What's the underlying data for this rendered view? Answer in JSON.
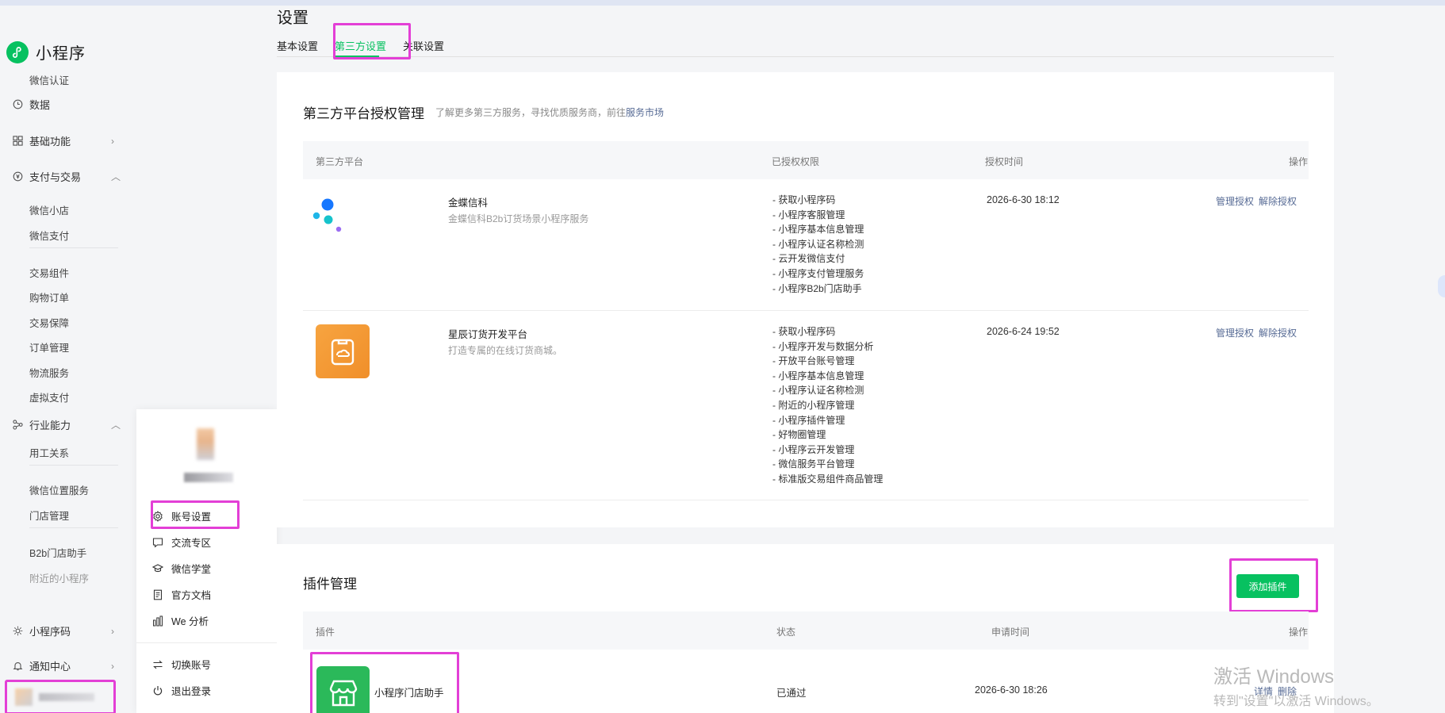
{
  "brand": {
    "name": "小程序",
    "color": "#07c160"
  },
  "sidebar": {
    "items": [
      {
        "label": "微信认证",
        "type": "sub"
      },
      {
        "label": "数据",
        "type": "group",
        "icon": "clock-icon"
      },
      {
        "label": "基础功能",
        "type": "group",
        "icon": "grid-icon",
        "chevron": "right"
      },
      {
        "label": "支付与交易",
        "type": "group",
        "icon": "yen-icon",
        "chevron": "up"
      },
      {
        "label": "微信小店",
        "type": "sub"
      },
      {
        "label": "微信支付",
        "type": "sub"
      },
      {
        "label": "交易组件",
        "type": "sub"
      },
      {
        "label": "购物订单",
        "type": "sub"
      },
      {
        "label": "交易保障",
        "type": "sub"
      },
      {
        "label": "订单管理",
        "type": "sub"
      },
      {
        "label": "物流服务",
        "type": "sub"
      },
      {
        "label": "虚拟支付",
        "type": "sub"
      },
      {
        "label": "行业能力",
        "type": "group",
        "icon": "nodes-icon",
        "chevron": "up"
      },
      {
        "label": "用工关系",
        "type": "sub"
      },
      {
        "label": "微信位置服务",
        "type": "sub"
      },
      {
        "label": "门店管理",
        "type": "sub"
      },
      {
        "label": "B2b门店助手",
        "type": "sub"
      },
      {
        "label": "附近的小程序",
        "type": "sub"
      },
      {
        "label": "小程序码",
        "type": "group",
        "icon": "sun-icon",
        "chevron": "right"
      },
      {
        "label": "通知中心",
        "type": "group",
        "icon": "bell-icon",
        "chevron": "right"
      }
    ]
  },
  "user_menu": {
    "items": [
      {
        "label": "账号设置",
        "icon": "gear-icon"
      },
      {
        "label": "交流专区",
        "icon": "chat-icon"
      },
      {
        "label": "微信学堂",
        "icon": "graduation-cap-icon"
      },
      {
        "label": "官方文档",
        "icon": "document-icon"
      },
      {
        "label": "We 分析",
        "icon": "bar-chart-icon"
      },
      {
        "label": "切换账号",
        "icon": "switch-icon"
      },
      {
        "label": "退出登录",
        "icon": "power-icon"
      }
    ]
  },
  "page": {
    "title": "设置",
    "tabs": [
      {
        "label": "基本设置",
        "active": false
      },
      {
        "label": "第三方设置",
        "active": true
      },
      {
        "label": "关联设置",
        "active": false
      }
    ]
  },
  "third_party": {
    "title": "第三方平台授权管理",
    "subtitle": "了解更多第三方服务，寻找优质服务商，前往",
    "subtitle_link": "服务市场",
    "columns": [
      "第三方平台",
      "已授权权限",
      "授权时间",
      "操作"
    ],
    "rows": [
      {
        "name": "金蝶信科",
        "desc": "金蝶信科B2b订货场景小程序服务",
        "permissions": [
          "- 获取小程序码",
          "- 小程序客服管理",
          "- 小程序基本信息管理",
          "- 小程序认证名称检测",
          "- 云开发微信支付",
          "- 小程序支付管理服务",
          "- 小程序B2b门店助手"
        ],
        "time": "2026-6-30 18:12",
        "actions": [
          "管理授权",
          "解除授权"
        ]
      },
      {
        "name": "星辰订货开发平台",
        "desc": "打造专属的在线订货商城。",
        "permissions": [
          "- 获取小程序码",
          "- 小程序开发与数据分析",
          "- 开放平台账号管理",
          "- 小程序基本信息管理",
          "- 小程序认证名称检测",
          "- 附近的小程序管理",
          "- 小程序插件管理",
          "- 好物圈管理",
          "- 小程序云开发管理",
          "- 微信服务平台管理",
          "- 标准版交易组件商品管理"
        ],
        "time": "2026-6-24 19:52",
        "actions": [
          "管理授权",
          "解除授权"
        ]
      }
    ]
  },
  "plugins": {
    "title": "插件管理",
    "add_label": "添加插件",
    "columns": [
      "插件",
      "状态",
      "申请时间",
      "操作"
    ],
    "rows": [
      {
        "name": "小程序门店助手",
        "status": "已通过",
        "time": "2026-6-30 18:26",
        "actions": [
          "详情",
          "删除"
        ]
      }
    ]
  },
  "watermark": {
    "line1": "激活 Windows",
    "line2": "转到\"设置\"以激活 Windows。"
  },
  "colors": {
    "accent": "#07c160",
    "link": "#576b95",
    "highlight": "#e33fd6"
  }
}
